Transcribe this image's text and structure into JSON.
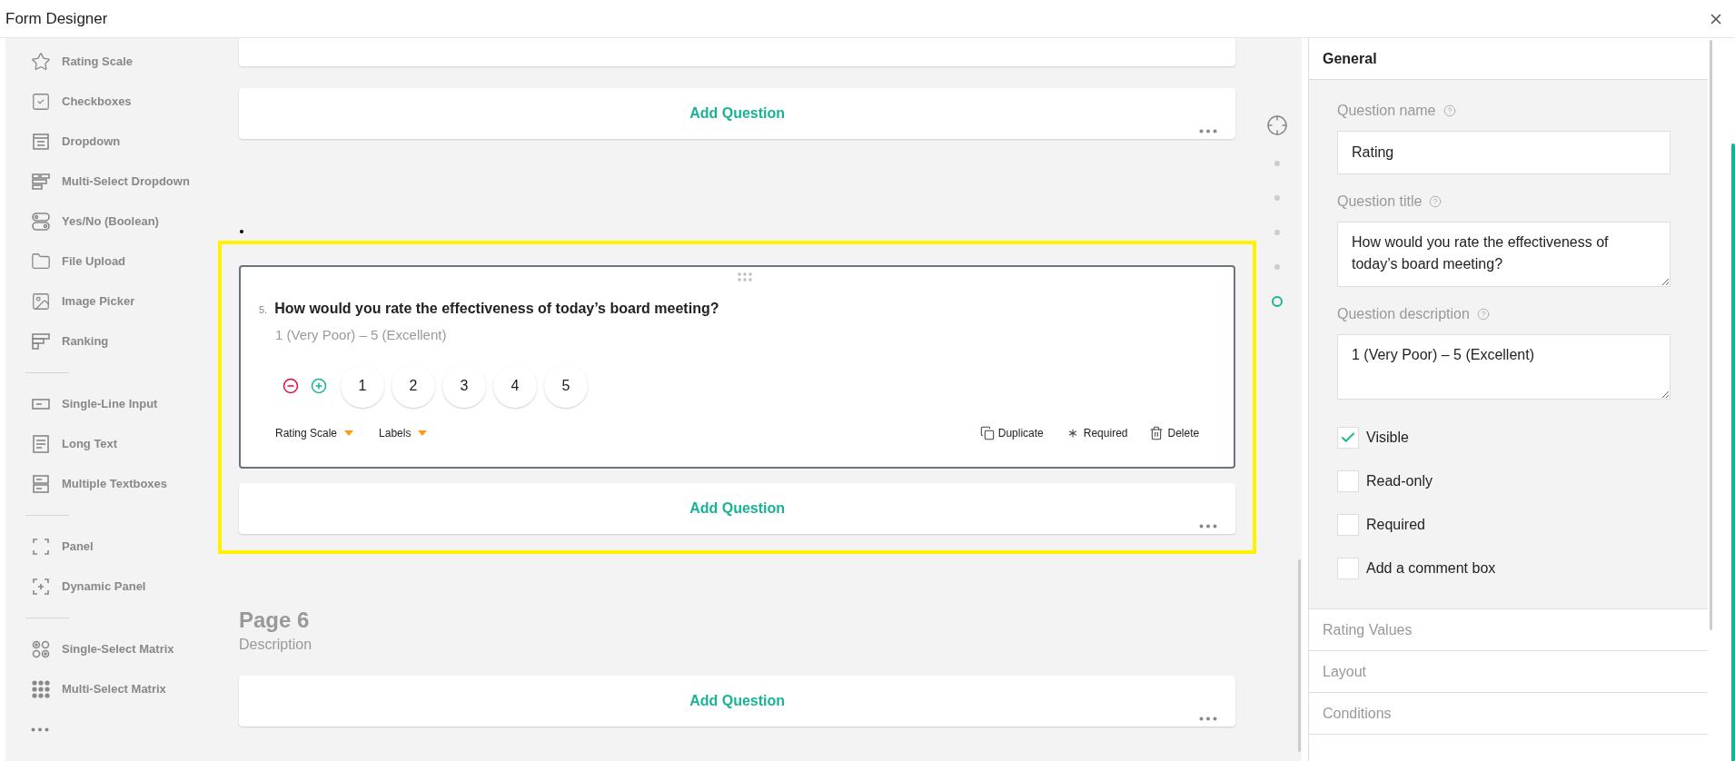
{
  "window": {
    "title": "Form Designer"
  },
  "toolbox": {
    "groups": [
      [
        {
          "label": "Rating Scale",
          "kind": "star"
        },
        {
          "label": "Checkboxes",
          "kind": "checkbox"
        },
        {
          "label": "Dropdown",
          "kind": "dropdown"
        },
        {
          "label": "Multi-Select Dropdown",
          "kind": "multidropdown"
        },
        {
          "label": "Yes/No (Boolean)",
          "kind": "toggle"
        },
        {
          "label": "File Upload",
          "kind": "folder"
        },
        {
          "label": "Image Picker",
          "kind": "image"
        },
        {
          "label": "Ranking",
          "kind": "ranking"
        }
      ],
      [
        {
          "label": "Single-Line Input",
          "kind": "input"
        },
        {
          "label": "Long Text",
          "kind": "longtext"
        },
        {
          "label": "Multiple Textboxes",
          "kind": "multitext"
        }
      ],
      [
        {
          "label": "Panel",
          "kind": "panel"
        },
        {
          "label": "Dynamic Panel",
          "kind": "dynpanel"
        }
      ],
      [
        {
          "label": "Single-Select Matrix",
          "kind": "matrix1"
        },
        {
          "label": "Multi-Select Matrix",
          "kind": "matrix2"
        }
      ]
    ]
  },
  "canvas": {
    "add_question_top": "Add Question",
    "question": {
      "number": "5.",
      "title": "How would you rate the effectiveness of today’s board meeting?",
      "description": "1 (Very Poor) – 5 (Excellent)",
      "rates": [
        "1",
        "2",
        "3",
        "4",
        "5"
      ],
      "menus": [
        "Rating Scale",
        "Labels"
      ],
      "actions": [
        {
          "label": "Duplicate",
          "kind": "duplicate"
        },
        {
          "label": "Required",
          "kind": "asterisk"
        },
        {
          "label": "Delete",
          "kind": "trash"
        }
      ]
    },
    "add_question_selected": "Add Question",
    "page": {
      "title": "Page 6",
      "description": "Description"
    },
    "add_question_bottom": "Add Question"
  },
  "navigator": [
    {
      "selected": false
    },
    {
      "selected": false
    },
    {
      "selected": false
    },
    {
      "selected": false
    },
    {
      "selected": true
    }
  ],
  "properties": {
    "sections": [
      {
        "title": "General",
        "expanded": true
      },
      {
        "title": "Rating Values",
        "expanded": false
      },
      {
        "title": "Layout",
        "expanded": false
      },
      {
        "title": "Conditions",
        "expanded": false
      }
    ],
    "fields": [
      {
        "label": "Question name",
        "value": "Rating",
        "kind": "input"
      },
      {
        "label": "Question title",
        "value": "How would you rate the effectiveness of today’s board meeting?",
        "kind": "textarea"
      },
      {
        "label": "Question description",
        "value": "1 (Very Poor) – 5 (Excellent)",
        "kind": "textarea"
      }
    ],
    "checkboxes": [
      {
        "label": "Visible",
        "checked": true
      },
      {
        "label": "Read-only",
        "checked": false
      },
      {
        "label": "Required",
        "checked": false
      },
      {
        "label": "Add a comment box",
        "checked": false
      }
    ]
  }
}
